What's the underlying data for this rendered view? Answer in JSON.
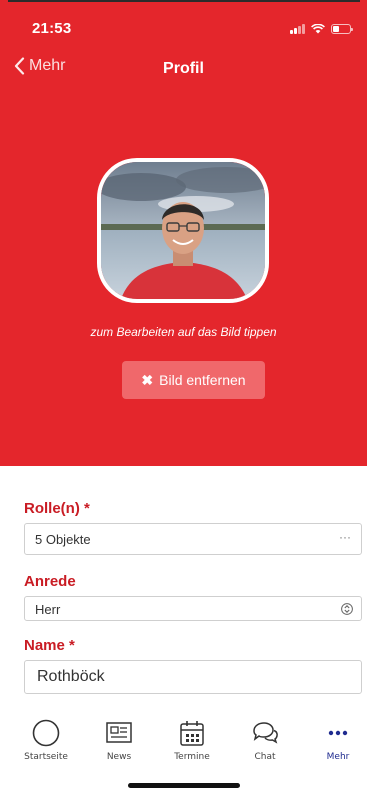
{
  "status": {
    "time": "21:53",
    "battery_level": 0.35
  },
  "nav": {
    "back_label": "Mehr",
    "title": "Profil"
  },
  "profile": {
    "photo_caption": "zum Bearbeiten auf das Bild tippen",
    "remove_button_label": "Bild entfernen"
  },
  "form": {
    "roles": {
      "label": "Rolle(n) *",
      "value": "5 Objekte",
      "more": "···"
    },
    "salutation": {
      "label": "Anrede",
      "value": "Herr"
    },
    "name": {
      "label": "Name *",
      "value": "Rothböck"
    }
  },
  "tabs": [
    {
      "label": "Startseite",
      "icon": "home-circle-icon"
    },
    {
      "label": "News",
      "icon": "newspaper-icon"
    },
    {
      "label": "Termine",
      "icon": "calendar-icon"
    },
    {
      "label": "Chat",
      "icon": "chat-bubbles-icon"
    },
    {
      "label": "Mehr",
      "icon": "more-dots-icon"
    }
  ],
  "colors": {
    "primary_red": "#e4262c",
    "label_red": "#c91c24",
    "button_red_light": "#f0686b",
    "active_tab": "#1f2b8f"
  }
}
